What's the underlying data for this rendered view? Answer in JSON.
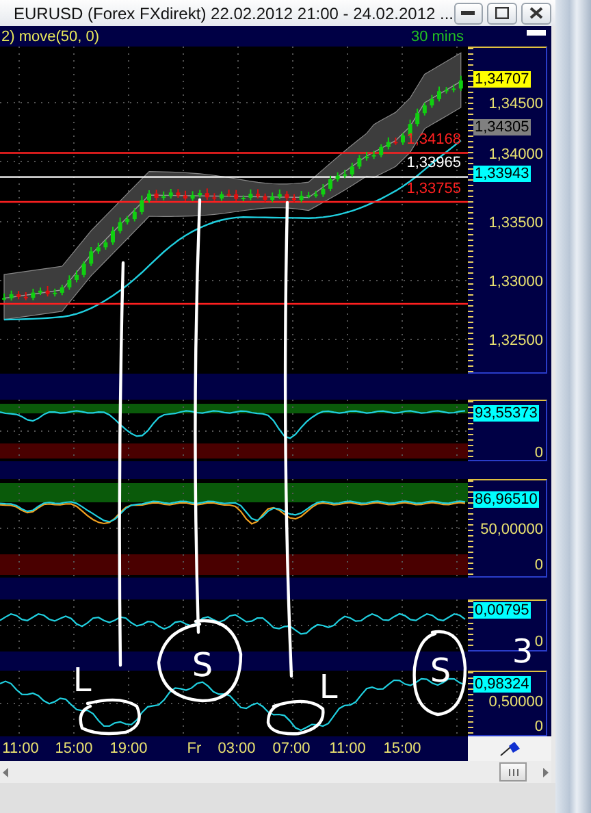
{
  "window": {
    "title": "EURUSD (Forex FXdirekt) 22.02.2012 21:00 - 24.02.2012 ..."
  },
  "chart_header": {
    "indicator": "2) move(50, 0)",
    "interval": "30 mins"
  },
  "price_panel": {
    "axis_labels": [
      "1,34500",
      "1,34000",
      "1,33500",
      "1,33000",
      "1,32500"
    ],
    "price_tags": [
      {
        "text": "1,34707",
        "color": "#ffff00"
      },
      {
        "text": "1,34305",
        "color": "#808080"
      },
      {
        "text": "1,33943",
        "color": "#00ffff"
      }
    ],
    "level_labels": [
      {
        "text": "1,34168",
        "color": "#ff2020"
      },
      {
        "text": "1,33965",
        "color": "#ffffff"
      },
      {
        "text": "1,33755",
        "color": "#ff2020"
      }
    ]
  },
  "indicator_panels": [
    {
      "value_tag": "93,55373",
      "axis_labels": [
        "0"
      ]
    },
    {
      "value_tag": "86,96510",
      "axis_labels": [
        "50,00000",
        "0"
      ]
    },
    {
      "value_tag": "0,00795",
      "axis_labels": [
        "0"
      ]
    },
    {
      "value_tag": "0,98324",
      "axis_labels": [
        "0,50000",
        "0"
      ]
    }
  ],
  "time_axis": [
    "11:00",
    "15:00",
    "19:00",
    "Fr",
    "03:00",
    "07:00",
    "11:00",
    "15:00"
  ],
  "annotations": [
    {
      "kind": "letter",
      "text": "L"
    },
    {
      "kind": "letter",
      "text": "S"
    },
    {
      "kind": "letter",
      "text": "L"
    },
    {
      "kind": "letter",
      "text": "S"
    },
    {
      "kind": "letter",
      "text": "3"
    }
  ]
}
